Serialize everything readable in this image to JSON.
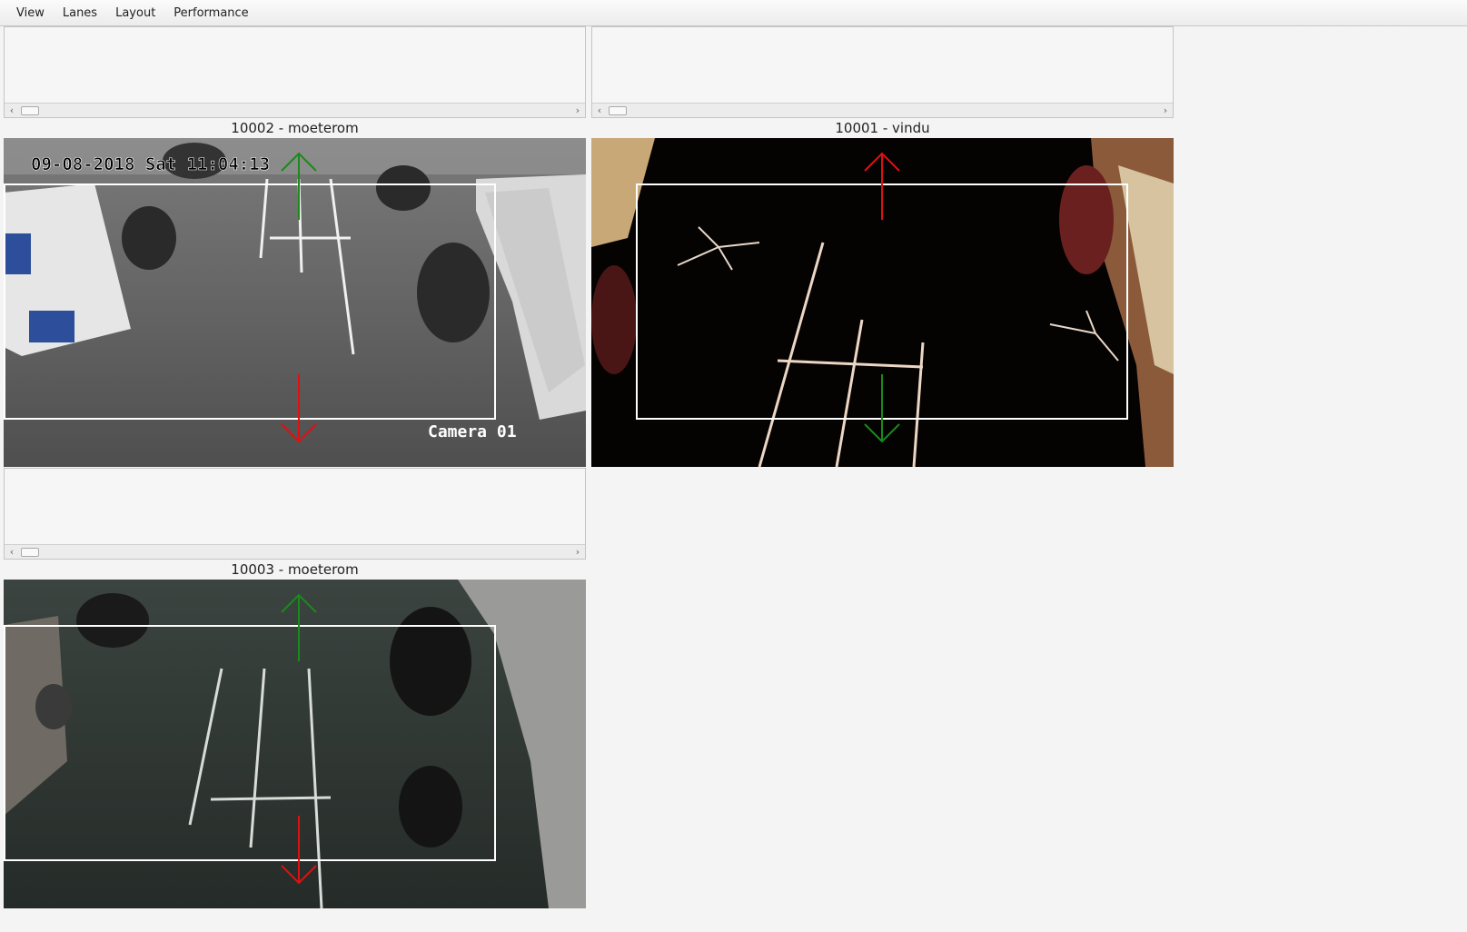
{
  "menu": [
    "View",
    "Lanes",
    "Layout",
    "Performance"
  ],
  "cameras": [
    {
      "title": "10002 - moeterom",
      "osd_timestamp": "09-08-2018 Sat 11:04:13",
      "osd_label": "Camera 01",
      "up_arrow_color": "#1a8a1a",
      "down_arrow_color": "#e01010",
      "roi_color": "#ffffff"
    },
    {
      "title": "10001 - vindu",
      "up_arrow_color": "#e01010",
      "down_arrow_color": "#1a8a1a",
      "roi_color": "#ffffff"
    },
    {
      "title": "10003 - moeterom",
      "up_arrow_color": "#1a8a1a",
      "down_arrow_color": "#e01010",
      "roi_color": "#ffffff"
    }
  ],
  "scroll_arrows": {
    "left": "‹",
    "right": "›"
  }
}
